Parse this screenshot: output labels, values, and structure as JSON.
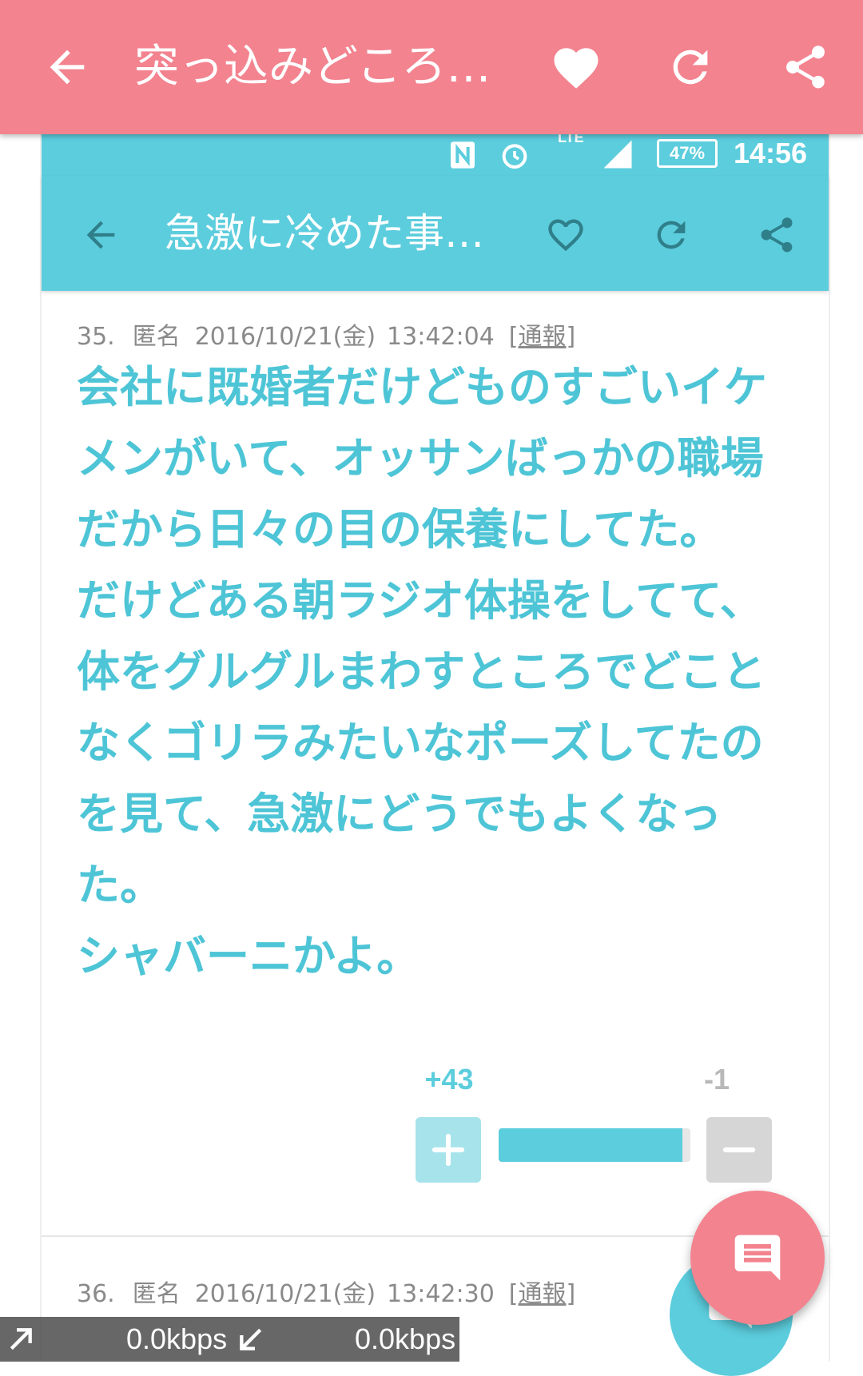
{
  "outer_bar": {
    "title": "突っ込みどころ…",
    "color": "#f3838f"
  },
  "inner_status_bar": {
    "network": "LTE",
    "battery": "47%",
    "time": "14:56"
  },
  "inner_bar": {
    "title": "急激に冷めた事…",
    "color": "#5ccddd"
  },
  "posts": [
    {
      "number": "35.",
      "name": "匿名",
      "date": "2016/10/21(金)",
      "time": "13:42:04",
      "report": "[通報]",
      "lines": [
        "会社に既婚者だけどものすごいイケ",
        "メンがいて、オッサンばっかの職場",
        "だから日々の目の保養にしてた。",
        "だけどある朝ラジオ体操をしてて、",
        "体をグルグルまわすところでどこと",
        "なくゴリラみたいなポーズしてたの",
        "を見て、急激にどうでもよくなっ",
        "た。",
        "シャバーニかよ。"
      ],
      "votes": {
        "plus": "+43",
        "minus": "-1",
        "plus_ratio": 0.96,
        "plus_button": "+",
        "minus_button": "−"
      }
    },
    {
      "number": "36.",
      "name": "匿名",
      "date": "2016/10/21(金)",
      "time": "13:42:30",
      "report": "[通報]"
    }
  ],
  "net_meter": {
    "upload": "0.0kbps",
    "download": "0.0kbps"
  },
  "icons": {
    "outer_back": "arrow-left-icon",
    "outer_heart": "heart-filled-icon",
    "outer_refresh": "refresh-icon",
    "outer_share": "share-icon",
    "inner_heart": "heart-outline-icon",
    "comment": "comment-icon"
  }
}
